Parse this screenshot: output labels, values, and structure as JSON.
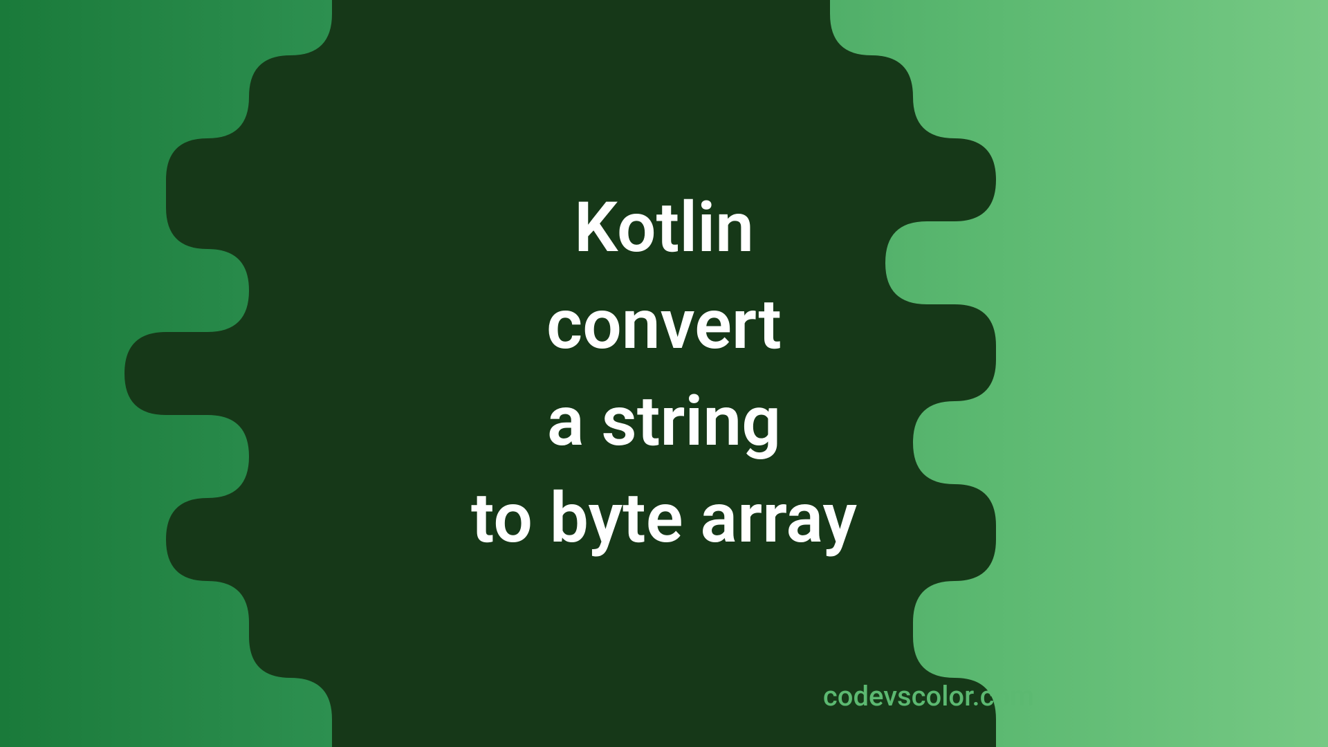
{
  "title": {
    "line1": "Kotlin",
    "line2": "convert",
    "line3": "a string",
    "line4": "to byte array"
  },
  "watermark": "codevscolor.com",
  "colors": {
    "blob": "#163818",
    "gradientStart": "#1a7a3a",
    "gradientEnd": "#76c984",
    "text": "#ffffff",
    "watermarkText": "#5cb971"
  }
}
